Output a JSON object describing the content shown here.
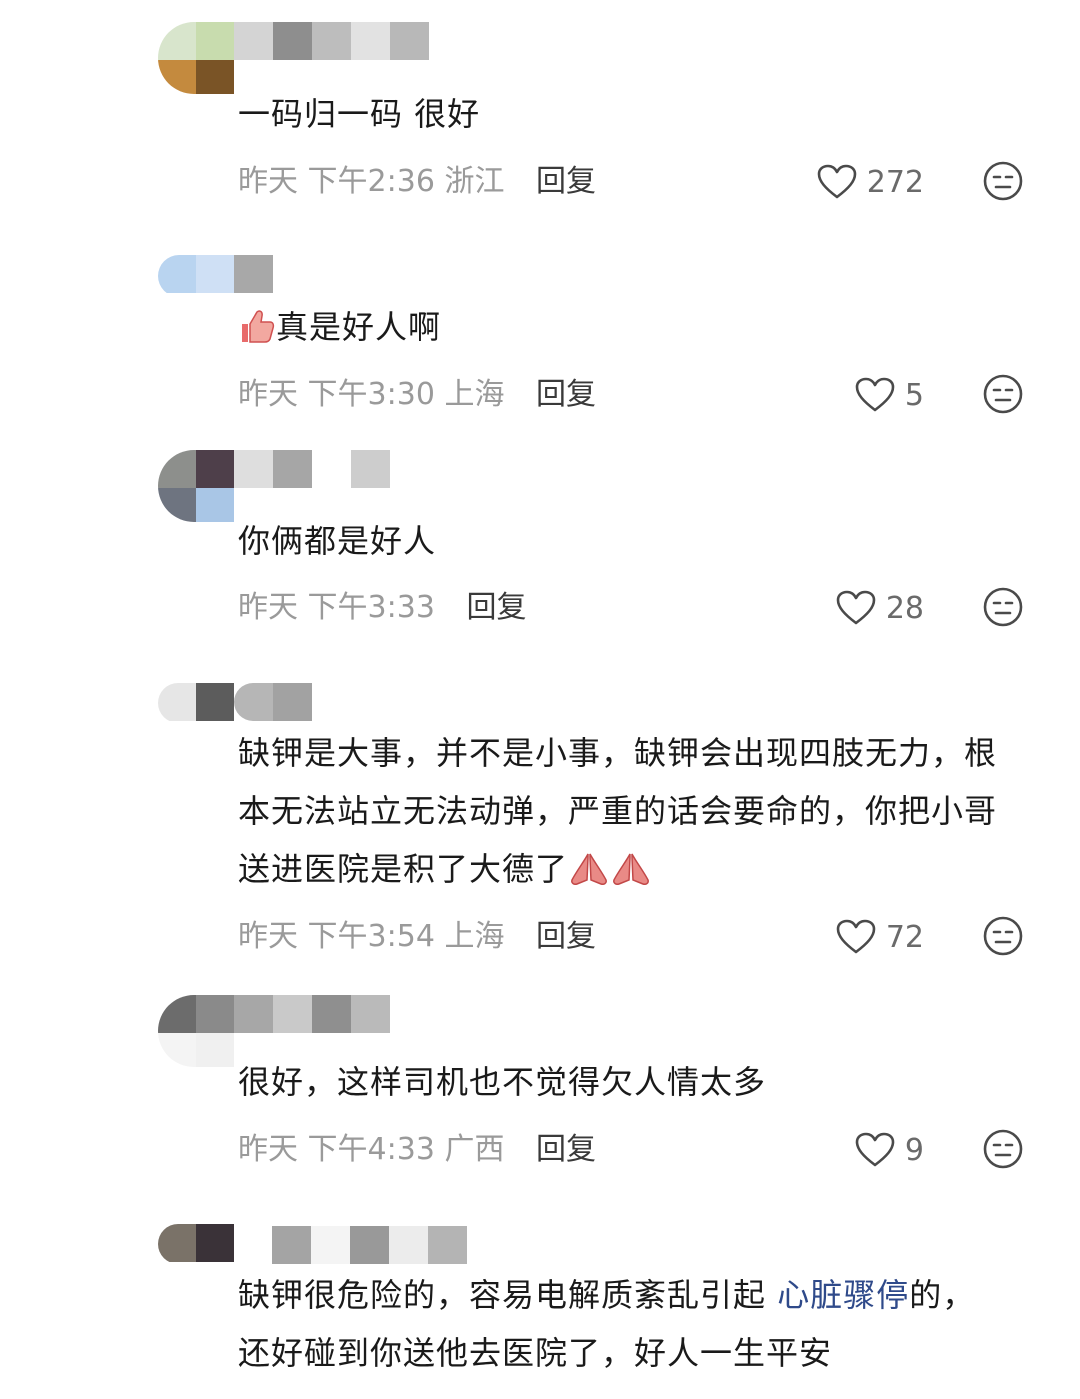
{
  "comments": [
    {
      "text": "一码归一码 很好",
      "time": "昨天 下午2:36",
      "location": "浙江",
      "reply_label": "回复",
      "likes": "272"
    },
    {
      "text": "真是好人啊",
      "emoji": "thumbs-up-emoji",
      "time": "昨天 下午3:30",
      "location": "上海",
      "reply_label": "回复",
      "likes": "5"
    },
    {
      "text": "你俩都是好人",
      "time": "昨天 下午3:33",
      "location": "",
      "reply_label": "回复",
      "likes": "28"
    },
    {
      "text": "缺钾是大事，并不是小事，缺钾会出现四肢无力，根本无法站立无法动弹，严重的话会要命的，你把小哥送进医院是积了大德了",
      "emoji": "praying-hands-emoji",
      "time": "昨天 下午3:54",
      "location": "上海",
      "reply_label": "回复",
      "likes": "72"
    },
    {
      "text": "很好，这样司机也不觉得欠人情太多",
      "time": "昨天 下午4:33",
      "location": "广西",
      "reply_label": "回复",
      "likes": "9"
    },
    {
      "text_before_link": "缺钾很危险的，容易电解质紊乱引起 ",
      "link_text": "心脏骤停",
      "text_after_link": "的，还好碰到你送他去医院了，好人一生平安"
    }
  ],
  "colors": {
    "meta_gray": "#9a9a9a",
    "reply": "#3a3a3a",
    "link_blue": "#2f4a8a"
  }
}
